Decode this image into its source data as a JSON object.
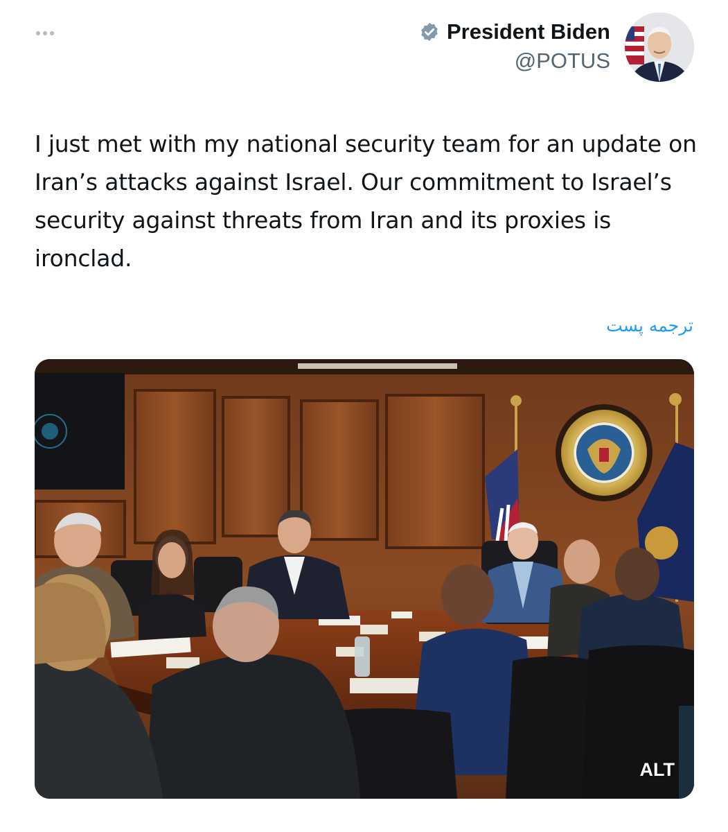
{
  "header": {
    "more_icon": "more-horizontal-icon"
  },
  "author": {
    "name": "President Biden",
    "handle": "@POTUS",
    "verified_icon": "verified-badge-icon",
    "badge_color": "#829aab"
  },
  "tweet": {
    "text": "I just met with my national security team for an update on Iran’s attacks against Israel. Our commitment to Israel’s security against threats from Iran and its proxies is ironclad.",
    "translate_label": "ترجمه پست"
  },
  "media": {
    "alt_label": "ALT"
  },
  "colors": {
    "text": "#0f1419",
    "secondary": "#536471",
    "link": "#1d9bf0"
  }
}
